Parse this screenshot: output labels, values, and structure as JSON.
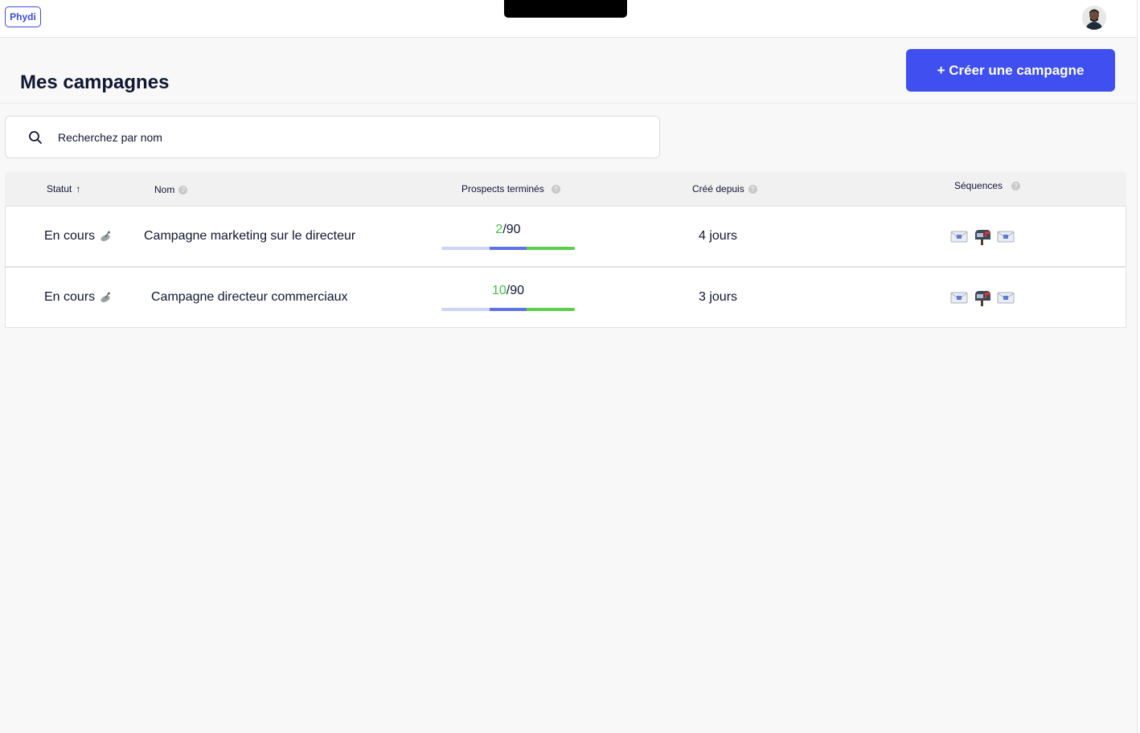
{
  "header": {
    "logo_text": "Phydi",
    "avatar_icon": "user-avatar"
  },
  "page": {
    "title": "Mes campagnes",
    "create_button": "+ Créer une campagne"
  },
  "search": {
    "placeholder": "Recherchez par nom",
    "icon": "search-icon"
  },
  "table": {
    "columns": {
      "status": "Statut",
      "name": "Nom",
      "prospects": "Prospects terminés",
      "created": "Créé depuis",
      "sequences": "Séquences"
    },
    "sort_indicator": "↑",
    "rows": [
      {
        "status": "En cours",
        "status_icon": "satellite-icon",
        "name": "Campagne marketing sur le directeur",
        "prospects_done": "2",
        "prospects_total": "/90",
        "created": "4 jours",
        "sequences": [
          "envelope-icon",
          "mailbox-icon",
          "envelope-icon"
        ]
      },
      {
        "status": "En cours",
        "status_icon": "satellite-icon",
        "name": "Campagne directeur commerciaux",
        "prospects_done": "10",
        "prospects_total": "/90",
        "created": "3 jours",
        "sequences": [
          "envelope-icon",
          "mailbox-icon",
          "envelope-icon"
        ]
      }
    ]
  },
  "colors": {
    "accent": "#4050f0",
    "success": "#3ec43e",
    "text": "#0f1733"
  }
}
